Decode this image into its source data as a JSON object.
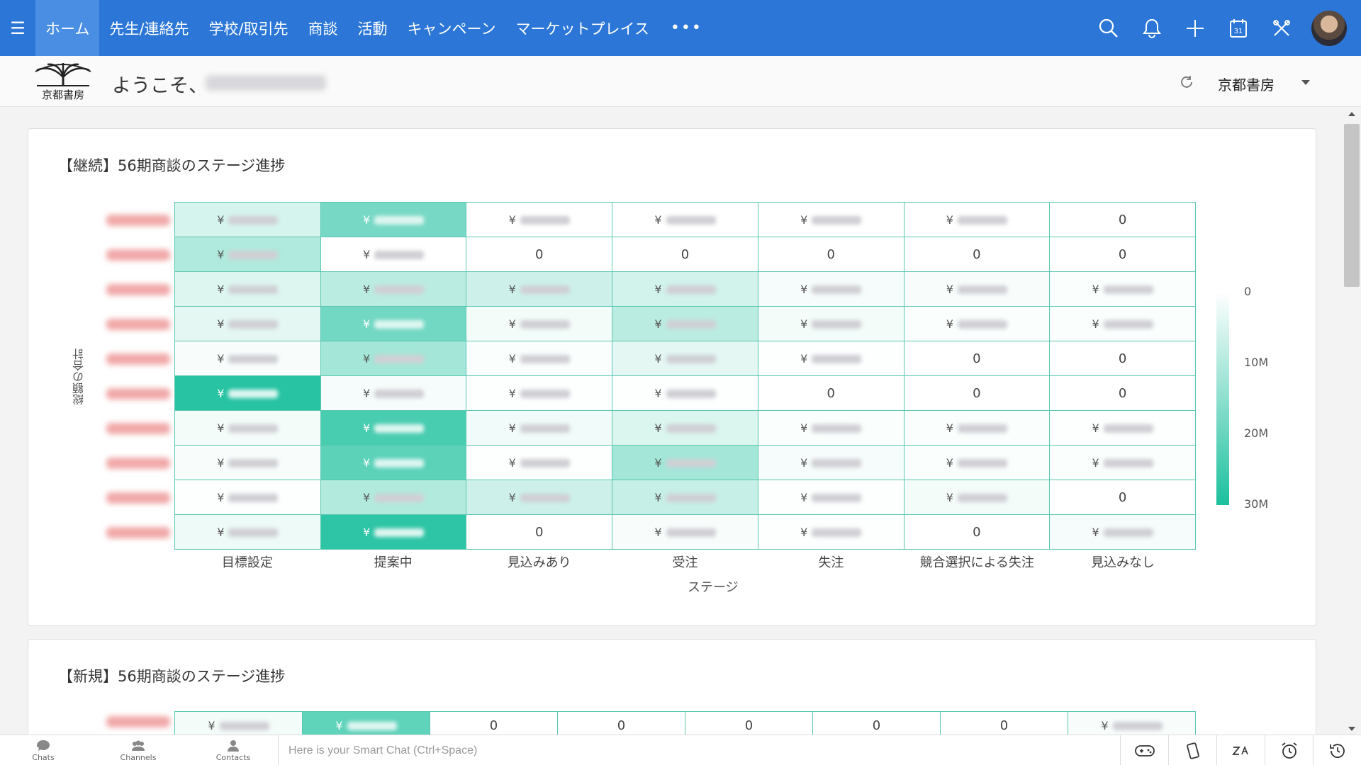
{
  "nav": {
    "tabs": [
      {
        "label": "ホーム",
        "active": true
      },
      {
        "label": "先生/連絡先"
      },
      {
        "label": "学校/取引先"
      },
      {
        "label": "商談"
      },
      {
        "label": "活動"
      },
      {
        "label": "キャンペーン"
      },
      {
        "label": "マーケットプレイス"
      }
    ],
    "more_label": "•••",
    "icons": [
      "search-icon",
      "bell-icon",
      "plus-icon",
      "calendar-icon",
      "tools-icon"
    ],
    "calendar_day": "31"
  },
  "welcome": {
    "greeting": "ようこそ、",
    "org_name": "京都書房",
    "logo_text": "京都書房"
  },
  "card1": {
    "title": "【継続】56期商談のステージ進捗",
    "y_label": "総額の合計",
    "x_label": "ステージ",
    "columns": [
      "目標設定",
      "提案中",
      "見込みあり",
      "受注",
      "失注",
      "競合選択による失注",
      "見込みなし"
    ],
    "legend": [
      "0",
      "10M",
      "20M",
      "30M"
    ]
  },
  "card2": {
    "title": "【新規】56期商談のステージ進捗",
    "first_row": [
      "¥",
      "¥",
      "0",
      "0",
      "0",
      "0",
      "0",
      "¥"
    ]
  },
  "bottom": {
    "items": [
      {
        "label": "Chats",
        "icon": "chat-icon"
      },
      {
        "label": "Channels",
        "icon": "channels-icon"
      },
      {
        "label": "Contacts",
        "icon": "contacts-icon"
      }
    ],
    "smart_chat_placeholder": "Here is your Smart Chat (Ctrl+Space)",
    "right_icons": [
      "gamepad-icon",
      "phone-icon",
      "draw-icon",
      "alarm-icon",
      "history-icon"
    ]
  },
  "colors": {
    "nav_bg": "#2b76d6",
    "nav_active": "#4a8ee3",
    "heat_max": "#1cc09e",
    "cell_border": "#59c7b0"
  },
  "chart_data": {
    "type": "heatmap",
    "title": "【継続】56期商談のステージ進捗",
    "xlabel": "ステージ",
    "ylabel": "総額の合計",
    "categories": [
      "目標設定",
      "提案中",
      "見込みあり",
      "受注",
      "失注",
      "競合選択による失注",
      "見込みなし"
    ],
    "color_scale": {
      "min": 0,
      "max": 30000000,
      "ticks": [
        "0",
        "10M",
        "20M",
        "30M"
      ]
    },
    "rows": [
      {
        "cells": [
          {
            "text": "¥",
            "level": 0.18
          },
          {
            "text": "¥",
            "level": 0.6
          },
          {
            "text": "¥",
            "level": 0
          },
          {
            "text": "¥",
            "level": 0
          },
          {
            "text": "¥",
            "level": 0
          },
          {
            "text": "¥",
            "level": 0
          },
          {
            "text": "0",
            "level": 0
          }
        ]
      },
      {
        "cells": [
          {
            "text": "¥",
            "level": 0.35
          },
          {
            "text": "¥",
            "level": 0
          },
          {
            "text": "0",
            "level": 0
          },
          {
            "text": "0",
            "level": 0
          },
          {
            "text": "0",
            "level": 0
          },
          {
            "text": "0",
            "level": 0
          },
          {
            "text": "0",
            "level": 0
          }
        ]
      },
      {
        "cells": [
          {
            "text": "¥",
            "level": 0.15
          },
          {
            "text": "¥",
            "level": 0.3
          },
          {
            "text": "¥",
            "level": 0.22
          },
          {
            "text": "¥",
            "level": 0.2
          },
          {
            "text": "¥",
            "level": 0.04
          },
          {
            "text": "¥",
            "level": 0.03
          },
          {
            "text": "¥",
            "level": 0.02
          }
        ]
      },
      {
        "cells": [
          {
            "text": "¥",
            "level": 0.12
          },
          {
            "text": "¥",
            "level": 0.62
          },
          {
            "text": "¥",
            "level": 0.05
          },
          {
            "text": "¥",
            "level": 0.3
          },
          {
            "text": "¥",
            "level": 0.05
          },
          {
            "text": "¥",
            "level": 0.02
          },
          {
            "text": "¥",
            "level": 0.02
          }
        ]
      },
      {
        "cells": [
          {
            "text": "¥",
            "level": 0.03
          },
          {
            "text": "¥",
            "level": 0.4
          },
          {
            "text": "¥",
            "level": 0.02
          },
          {
            "text": "¥",
            "level": 0.12
          },
          {
            "text": "¥",
            "level": 0.01
          },
          {
            "text": "0",
            "level": 0
          },
          {
            "text": "0",
            "level": 0
          }
        ]
      },
      {
        "cells": [
          {
            "text": "¥",
            "level": 0.95
          },
          {
            "text": "¥",
            "level": 0.04
          },
          {
            "text": "¥",
            "level": 0.01
          },
          {
            "text": "¥",
            "level": 0.01
          },
          {
            "text": "0",
            "level": 0
          },
          {
            "text": "0",
            "level": 0
          },
          {
            "text": "0",
            "level": 0
          }
        ]
      },
      {
        "cells": [
          {
            "text": "¥",
            "level": 0.05
          },
          {
            "text": "¥",
            "level": 0.8
          },
          {
            "text": "¥",
            "level": 0.06
          },
          {
            "text": "¥",
            "level": 0.16
          },
          {
            "text": "¥",
            "level": 0.02
          },
          {
            "text": "¥",
            "level": 0.02
          },
          {
            "text": "¥",
            "level": 0.01
          }
        ]
      },
      {
        "cells": [
          {
            "text": "¥",
            "level": 0.03
          },
          {
            "text": "¥",
            "level": 0.72
          },
          {
            "text": "¥",
            "level": 0.01
          },
          {
            "text": "¥",
            "level": 0.4
          },
          {
            "text": "¥",
            "level": 0.04
          },
          {
            "text": "¥",
            "level": 0.02
          },
          {
            "text": "¥",
            "level": 0.02
          }
        ]
      },
      {
        "cells": [
          {
            "text": "¥",
            "level": 0.01
          },
          {
            "text": "¥",
            "level": 0.34
          },
          {
            "text": "¥",
            "level": 0.22
          },
          {
            "text": "¥",
            "level": 0.25
          },
          {
            "text": "¥",
            "level": 0.01
          },
          {
            "text": "¥",
            "level": 0.05
          },
          {
            "text": "0",
            "level": 0
          }
        ]
      },
      {
        "cells": [
          {
            "text": "¥",
            "level": 0.08
          },
          {
            "text": "¥",
            "level": 0.92
          },
          {
            "text": "0",
            "level": 0
          },
          {
            "text": "¥",
            "level": 0.03
          },
          {
            "text": "¥",
            "level": 0.01
          },
          {
            "text": "0",
            "level": 0
          },
          {
            "text": "¥",
            "level": 0.04
          }
        ]
      }
    ]
  }
}
